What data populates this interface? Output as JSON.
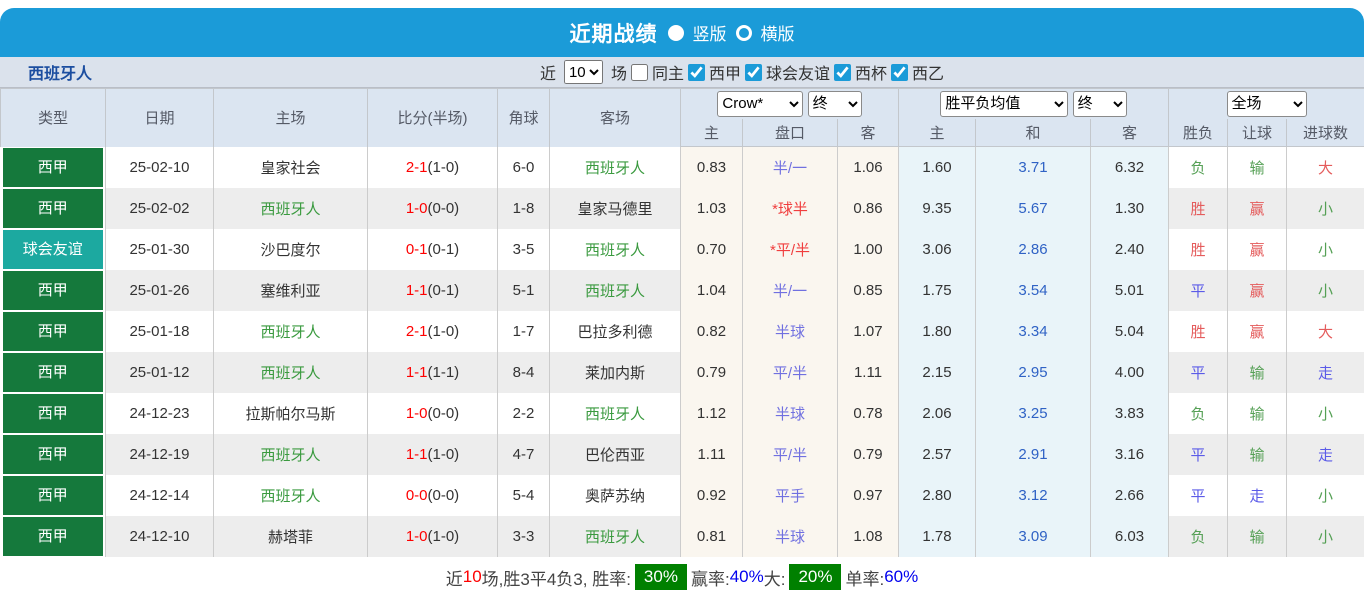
{
  "titlebar": {
    "title": "近期战绩",
    "radio_vertical": "竖版",
    "radio_horizontal": "横版"
  },
  "filters": {
    "team": "西班牙人",
    "recent_label": "近",
    "recent_value": "10",
    "matches_label": "场",
    "same_home_label": "同主",
    "leagues": [
      "西甲",
      "球会友谊",
      "西杯",
      "西乙"
    ]
  },
  "table": {
    "static_headers": [
      "类型",
      "日期",
      "主场",
      "比分(半场)",
      "角球",
      "客场"
    ],
    "group_odds": {
      "dropdown_company": "Crow*",
      "dropdown_time": "终",
      "cols": [
        "主",
        "盘口",
        "客"
      ]
    },
    "group_avg": {
      "dropdown_name": "胜平负均值",
      "dropdown_time": "终",
      "cols": [
        "主",
        "和",
        "客"
      ]
    },
    "group_result": {
      "dropdown_scope": "全场",
      "cols": [
        "胜负",
        "让球",
        "进球数"
      ]
    },
    "rows": [
      {
        "type": "西甲",
        "type_style": "league",
        "date": "25-02-10",
        "home": "皇家社会",
        "home_hl": false,
        "score": "2-1",
        "half": "(1-0)",
        "corner": "6-0",
        "away": "西班牙人",
        "away_hl": true,
        "odds_home": "0.83",
        "handicap": "半/一",
        "handicap_style": "blue",
        "odds_away": "1.06",
        "avg_home": "1.60",
        "avg_draw": "3.71",
        "avg_away": "6.32",
        "results": [
          [
            "负",
            "green"
          ],
          [
            "输",
            "green"
          ],
          [
            "大",
            "red"
          ]
        ]
      },
      {
        "type": "西甲",
        "type_style": "league",
        "date": "25-02-02",
        "home": "西班牙人",
        "home_hl": true,
        "score": "1-0",
        "half": "(0-0)",
        "corner": "1-8",
        "away": "皇家马德里",
        "away_hl": false,
        "odds_home": "1.03",
        "handicap": "*球半",
        "handicap_style": "red",
        "odds_away": "0.86",
        "avg_home": "9.35",
        "avg_draw": "5.67",
        "avg_away": "1.30",
        "results": [
          [
            "胜",
            "red"
          ],
          [
            "赢",
            "red"
          ],
          [
            "小",
            "green"
          ]
        ]
      },
      {
        "type": "球会友谊",
        "type_style": "friendly",
        "date": "25-01-30",
        "home": "沙巴度尔",
        "home_hl": false,
        "score": "0-1",
        "half": "(0-1)",
        "corner": "3-5",
        "away": "西班牙人",
        "away_hl": true,
        "odds_home": "0.70",
        "handicap": "*平/半",
        "handicap_style": "red",
        "odds_away": "1.00",
        "avg_home": "3.06",
        "avg_draw": "2.86",
        "avg_away": "2.40",
        "results": [
          [
            "胜",
            "red"
          ],
          [
            "赢",
            "red"
          ],
          [
            "小",
            "green"
          ]
        ]
      },
      {
        "type": "西甲",
        "type_style": "league",
        "date": "25-01-26",
        "home": "塞维利亚",
        "home_hl": false,
        "score": "1-1",
        "half": "(0-1)",
        "corner": "5-1",
        "away": "西班牙人",
        "away_hl": true,
        "odds_home": "1.04",
        "handicap": "半/一",
        "handicap_style": "blue",
        "odds_away": "0.85",
        "avg_home": "1.75",
        "avg_draw": "3.54",
        "avg_away": "5.01",
        "results": [
          [
            "平",
            "blue"
          ],
          [
            "赢",
            "red"
          ],
          [
            "小",
            "green"
          ]
        ]
      },
      {
        "type": "西甲",
        "type_style": "league",
        "date": "25-01-18",
        "home": "西班牙人",
        "home_hl": true,
        "score": "2-1",
        "half": "(1-0)",
        "corner": "1-7",
        "away": "巴拉多利德",
        "away_hl": false,
        "odds_home": "0.82",
        "handicap": "半球",
        "handicap_style": "blue",
        "odds_away": "1.07",
        "avg_home": "1.80",
        "avg_draw": "3.34",
        "avg_away": "5.04",
        "results": [
          [
            "胜",
            "red"
          ],
          [
            "赢",
            "red"
          ],
          [
            "大",
            "red"
          ]
        ]
      },
      {
        "type": "西甲",
        "type_style": "league",
        "date": "25-01-12",
        "home": "西班牙人",
        "home_hl": true,
        "score": "1-1",
        "half": "(1-1)",
        "corner": "8-4",
        "away": "莱加内斯",
        "away_hl": false,
        "odds_home": "0.79",
        "handicap": "平/半",
        "handicap_style": "blue",
        "odds_away": "1.11",
        "avg_home": "2.15",
        "avg_draw": "2.95",
        "avg_away": "4.00",
        "results": [
          [
            "平",
            "blue"
          ],
          [
            "输",
            "green"
          ],
          [
            "走",
            "blue"
          ]
        ]
      },
      {
        "type": "西甲",
        "type_style": "league",
        "date": "24-12-23",
        "home": "拉斯帕尔马斯",
        "home_hl": false,
        "score": "1-0",
        "half": "(0-0)",
        "corner": "2-2",
        "away": "西班牙人",
        "away_hl": true,
        "odds_home": "1.12",
        "handicap": "半球",
        "handicap_style": "blue",
        "odds_away": "0.78",
        "avg_home": "2.06",
        "avg_draw": "3.25",
        "avg_away": "3.83",
        "results": [
          [
            "负",
            "green"
          ],
          [
            "输",
            "green"
          ],
          [
            "小",
            "green"
          ]
        ]
      },
      {
        "type": "西甲",
        "type_style": "league",
        "date": "24-12-19",
        "home": "西班牙人",
        "home_hl": true,
        "score": "1-1",
        "half": "(1-0)",
        "corner": "4-7",
        "away": "巴伦西亚",
        "away_hl": false,
        "odds_home": "1.11",
        "handicap": "平/半",
        "handicap_style": "blue",
        "odds_away": "0.79",
        "avg_home": "2.57",
        "avg_draw": "2.91",
        "avg_away": "3.16",
        "results": [
          [
            "平",
            "blue"
          ],
          [
            "输",
            "green"
          ],
          [
            "走",
            "blue"
          ]
        ]
      },
      {
        "type": "西甲",
        "type_style": "league",
        "date": "24-12-14",
        "home": "西班牙人",
        "home_hl": true,
        "score": "0-0",
        "half": "(0-0)",
        "corner": "5-4",
        "away": "奥萨苏纳",
        "away_hl": false,
        "odds_home": "0.92",
        "handicap": "平手",
        "handicap_style": "blue",
        "odds_away": "0.97",
        "avg_home": "2.80",
        "avg_draw": "3.12",
        "avg_away": "2.66",
        "results": [
          [
            "平",
            "blue"
          ],
          [
            "走",
            "blue"
          ],
          [
            "小",
            "green"
          ]
        ]
      },
      {
        "type": "西甲",
        "type_style": "league",
        "date": "24-12-10",
        "home": "赫塔菲",
        "home_hl": false,
        "score": "1-0",
        "half": "(1-0)",
        "corner": "3-3",
        "away": "西班牙人",
        "away_hl": true,
        "odds_home": "0.81",
        "handicap": "半球",
        "handicap_style": "blue",
        "odds_away": "1.08",
        "avg_home": "1.78",
        "avg_draw": "3.09",
        "avg_away": "6.03",
        "results": [
          [
            "负",
            "green"
          ],
          [
            "输",
            "green"
          ],
          [
            "小",
            "green"
          ]
        ]
      }
    ]
  },
  "summary": {
    "parts": [
      {
        "text": "近",
        "style": "dark"
      },
      {
        "text": "10",
        "style": "red"
      },
      {
        "text": "场,胜3平4负3, 胜率:",
        "style": "dark"
      },
      {
        "text": "30%",
        "style": "badge"
      },
      {
        "text": "赢率:",
        "style": "dark"
      },
      {
        "text": "40%",
        "style": "blue"
      },
      {
        "text": " 大:",
        "style": "dark"
      },
      {
        "text": "20%",
        "style": "badge"
      },
      {
        "text": "单率:",
        "style": "blue-label"
      },
      {
        "text": "60%",
        "style": "blue"
      }
    ]
  },
  "colors": {
    "topbar_blue": "#1b9bd8",
    "league_green": "#15793c",
    "friendly_teal": "#1ca9a0",
    "team_green": "#3a9a3f",
    "score_red": "#fe0000",
    "handicap_blue": "#7070e0",
    "handicap_red": "#f03e3e",
    "avg_draw_blue": "#2f62c5",
    "result_red": "#e45c5c",
    "result_green": "#55a055",
    "result_blue": "#5b5be8",
    "badge_green": "#008000",
    "rate_blue": "#0000ee"
  }
}
